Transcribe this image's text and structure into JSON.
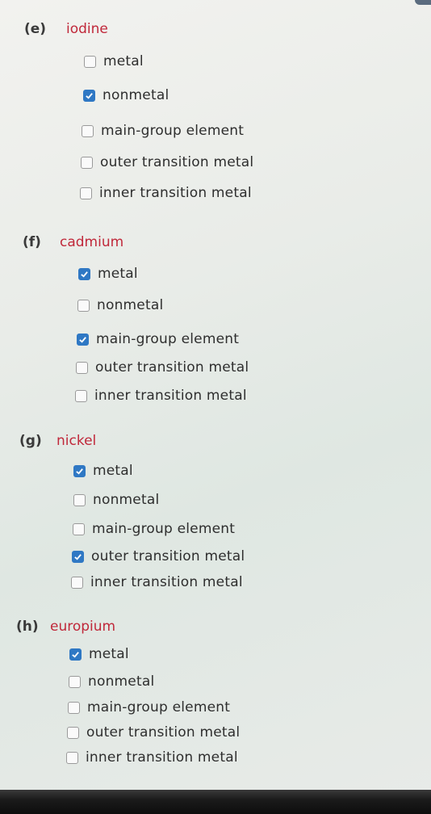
{
  "questions": [
    {
      "letter": "(e)",
      "element": "iodine",
      "options": [
        {
          "label": "metal",
          "checked": false
        },
        {
          "label": "nonmetal",
          "checked": true
        },
        {
          "label": "main-group element",
          "checked": false
        },
        {
          "label": "outer transition metal",
          "checked": false
        },
        {
          "label": "inner transition metal",
          "checked": false
        }
      ]
    },
    {
      "letter": "(f)",
      "element": "cadmium",
      "options": [
        {
          "label": "metal",
          "checked": true
        },
        {
          "label": "nonmetal",
          "checked": false
        },
        {
          "label": "main-group element",
          "checked": true
        },
        {
          "label": "outer transition metal",
          "checked": false
        },
        {
          "label": "inner transition metal",
          "checked": false
        }
      ]
    },
    {
      "letter": "(g)",
      "element": "nickel",
      "options": [
        {
          "label": "metal",
          "checked": true
        },
        {
          "label": "nonmetal",
          "checked": false
        },
        {
          "label": "main-group element",
          "checked": false
        },
        {
          "label": "outer transition metal",
          "checked": true
        },
        {
          "label": "inner transition metal",
          "checked": false
        }
      ]
    },
    {
      "letter": "(h)",
      "element": "europium",
      "options": [
        {
          "label": "metal",
          "checked": true
        },
        {
          "label": "nonmetal",
          "checked": false
        },
        {
          "label": "main-group element",
          "checked": false
        },
        {
          "label": "outer transition metal",
          "checked": false
        },
        {
          "label": "inner transition metal",
          "checked": false
        }
      ]
    }
  ],
  "colors": {
    "element_name": "#c0283a",
    "checkbox_checked": "#2f78c4"
  }
}
